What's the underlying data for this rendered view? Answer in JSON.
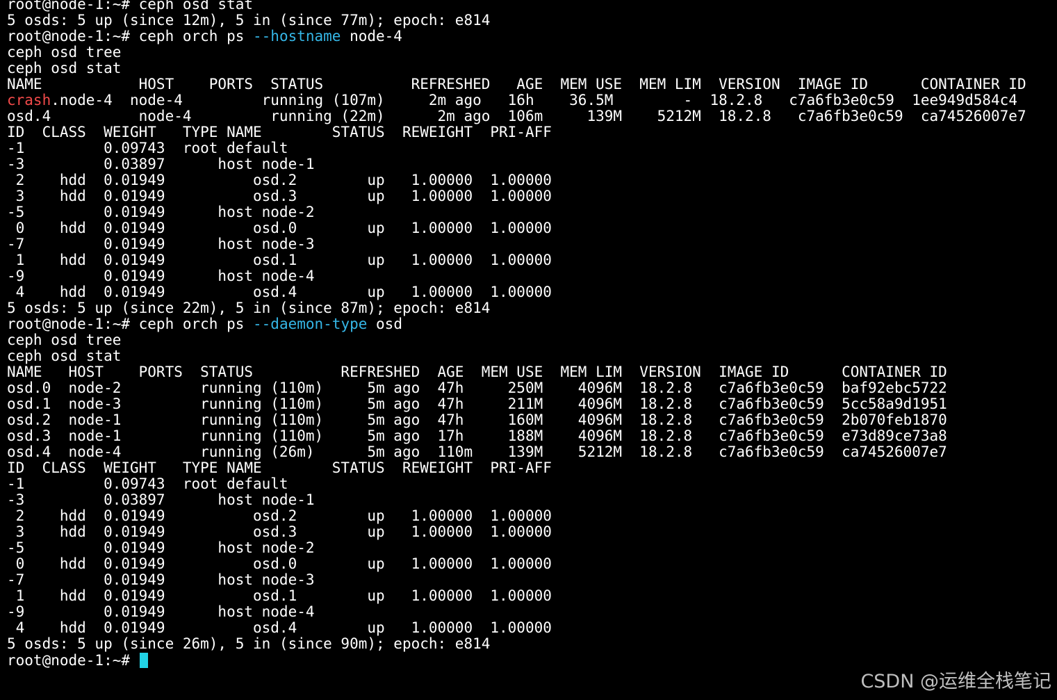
{
  "theme": {
    "background": "#000000",
    "foreground": "#ffffff",
    "option_color": "#35b6e6",
    "highlight_color": "#f24a4a",
    "cursor_color": "#22d3e6",
    "watermark_color": "#bfbfbf"
  },
  "terminal": {
    "lines": [
      [
        {
          "t": "root@node-1:~# ceph osd stat"
        }
      ],
      [
        {
          "t": "5 osds: 5 up (since 12m), 5 in (since 77m); epoch: e814"
        }
      ],
      [
        {
          "t": "root@node-1:~# ceph orch ps "
        },
        {
          "t": "--hostname",
          "c": "option"
        },
        {
          "t": " node-4"
        }
      ],
      [
        {
          "t": "ceph osd tree"
        }
      ],
      [
        {
          "t": "ceph osd stat"
        }
      ],
      [
        {
          "t": "NAME           HOST    PORTS  STATUS          REFRESHED   AGE  MEM USE  MEM LIM  VERSION  IMAGE ID      CONTAINER ID"
        }
      ],
      [
        {
          "t": "crash",
          "c": "highlight"
        },
        {
          "t": ".node-4  node-4         running (107m)     2m ago   16h    36.5M        -  18.2.8   c7a6fb3e0c59  1ee949d584c4"
        }
      ],
      [
        {
          "t": "osd.4          node-4         running (22m)      2m ago  106m     139M    5212M  18.2.8   c7a6fb3e0c59  ca74526007e7"
        }
      ],
      [
        {
          "t": "ID  CLASS  WEIGHT   TYPE NAME        STATUS  REWEIGHT  PRI-AFF"
        }
      ],
      [
        {
          "t": "-1         0.09743  root default"
        }
      ],
      [
        {
          "t": "-3         0.03897      host node-1"
        }
      ],
      [
        {
          "t": " 2    hdd  0.01949          osd.2        up   1.00000  1.00000"
        }
      ],
      [
        {
          "t": " 3    hdd  0.01949          osd.3        up   1.00000  1.00000"
        }
      ],
      [
        {
          "t": "-5         0.01949      host node-2"
        }
      ],
      [
        {
          "t": " 0    hdd  0.01949          osd.0        up   1.00000  1.00000"
        }
      ],
      [
        {
          "t": "-7         0.01949      host node-3"
        }
      ],
      [
        {
          "t": " 1    hdd  0.01949          osd.1        up   1.00000  1.00000"
        }
      ],
      [
        {
          "t": "-9         0.01949      host node-4"
        }
      ],
      [
        {
          "t": " 4    hdd  0.01949          osd.4        up   1.00000  1.00000"
        }
      ],
      [
        {
          "t": "5 osds: 5 up (since 22m), 5 in (since 87m); epoch: e814"
        }
      ],
      [
        {
          "t": "root@node-1:~# ceph orch ps "
        },
        {
          "t": "--daemon-type",
          "c": "option"
        },
        {
          "t": " osd"
        }
      ],
      [
        {
          "t": "ceph osd tree"
        }
      ],
      [
        {
          "t": "ceph osd stat"
        }
      ],
      [
        {
          "t": "NAME   HOST    PORTS  STATUS          REFRESHED  AGE  MEM USE  MEM LIM  VERSION  IMAGE ID      CONTAINER ID"
        }
      ],
      [
        {
          "t": "osd.0  node-2         running (110m)     5m ago  47h     250M    4096M  18.2.8   c7a6fb3e0c59  baf92ebc5722"
        }
      ],
      [
        {
          "t": "osd.1  node-3         running (110m)     5m ago  47h     211M    4096M  18.2.8   c7a6fb3e0c59  5cc58a9d1951"
        }
      ],
      [
        {
          "t": "osd.2  node-1         running (110m)     5m ago  47h     160M    4096M  18.2.8   c7a6fb3e0c59  2b070feb1870"
        }
      ],
      [
        {
          "t": "osd.3  node-1         running (110m)     5m ago  17h     188M    4096M  18.2.8   c7a6fb3e0c59  e73d89ce73a8"
        }
      ],
      [
        {
          "t": "osd.4  node-4         running (26m)      5m ago  110m    139M    5212M  18.2.8   c7a6fb3e0c59  ca74526007e7"
        }
      ],
      [
        {
          "t": "ID  CLASS  WEIGHT   TYPE NAME        STATUS  REWEIGHT  PRI-AFF"
        }
      ],
      [
        {
          "t": "-1         0.09743  root default"
        }
      ],
      [
        {
          "t": "-3         0.03897      host node-1"
        }
      ],
      [
        {
          "t": " 2    hdd  0.01949          osd.2        up   1.00000  1.00000"
        }
      ],
      [
        {
          "t": " 3    hdd  0.01949          osd.3        up   1.00000  1.00000"
        }
      ],
      [
        {
          "t": "-5         0.01949      host node-2"
        }
      ],
      [
        {
          "t": " 0    hdd  0.01949          osd.0        up   1.00000  1.00000"
        }
      ],
      [
        {
          "t": "-7         0.01949      host node-3"
        }
      ],
      [
        {
          "t": " 1    hdd  0.01949          osd.1        up   1.00000  1.00000"
        }
      ],
      [
        {
          "t": "-9         0.01949      host node-4"
        }
      ],
      [
        {
          "t": " 4    hdd  0.01949          osd.4        up   1.00000  1.00000"
        }
      ],
      [
        {
          "t": "5 osds: 5 up (since 26m), 5 in (since 90m); epoch: e814"
        }
      ],
      [
        {
          "t": "root@node-1:~# "
        },
        {
          "t": "",
          "c": "cursor"
        }
      ]
    ]
  },
  "watermark": {
    "text": "CSDN @运维全栈笔记"
  }
}
